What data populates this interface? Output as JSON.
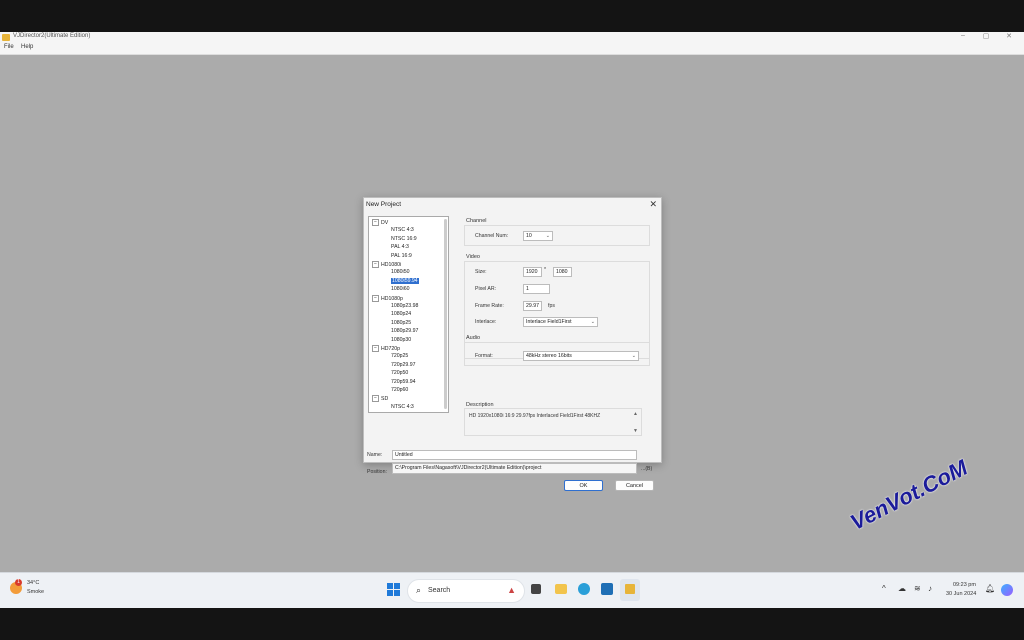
{
  "window": {
    "title": "VJDirector2(Ultimate Edition)",
    "controls": [
      "–",
      "▢",
      "✕"
    ]
  },
  "menu": [
    "File",
    "Help"
  ],
  "dialog": {
    "title": "New Project",
    "close": "✕",
    "tree": [
      {
        "label": "DV",
        "level": 0,
        "toggle": "−"
      },
      {
        "label": "NTSC 4:3",
        "level": 1
      },
      {
        "label": "NTSC 16:9",
        "level": 1
      },
      {
        "label": "PAL 4:3",
        "level": 1
      },
      {
        "label": "PAL 16:9",
        "level": 1
      },
      {
        "label": "HD1080i",
        "level": 0,
        "toggle": "−"
      },
      {
        "label": "1080i50",
        "level": 1
      },
      {
        "label": "1080i59.94",
        "level": 1,
        "selected": true
      },
      {
        "label": "1080i60",
        "level": 1
      },
      {
        "label": "HD1080p",
        "level": 0,
        "toggle": "−"
      },
      {
        "label": "1080p23.98",
        "level": 1
      },
      {
        "label": "1080p24",
        "level": 1
      },
      {
        "label": "1080p25",
        "level": 1
      },
      {
        "label": "1080p29.97",
        "level": 1
      },
      {
        "label": "1080p30",
        "level": 1
      },
      {
        "label": "HD720p",
        "level": 0,
        "toggle": "−"
      },
      {
        "label": "720p25",
        "level": 1
      },
      {
        "label": "720p29.97",
        "level": 1
      },
      {
        "label": "720p50",
        "level": 1
      },
      {
        "label": "720p59.94",
        "level": 1
      },
      {
        "label": "720p60",
        "level": 1
      },
      {
        "label": "SD",
        "level": 0,
        "toggle": "−"
      },
      {
        "label": "NTSC 4:3",
        "level": 1
      }
    ],
    "channel": {
      "group": "Channel",
      "num_label": "Channel Num:",
      "num_value": "10"
    },
    "video": {
      "group": "Video",
      "size_label": "Size:",
      "size_w": "1920",
      "size_sep": "*",
      "size_h": "1080",
      "pixel_label": "Pixel AR:",
      "pixel_value": "1",
      "frame_label": "Frame Rate:",
      "frame_value": "29.97",
      "frame_unit": "fps",
      "interlace_label": "Interlace:",
      "interlace_value": "Interlace Field1First"
    },
    "audio": {
      "group": "Audio",
      "format_label": "Format:",
      "format_value": "48kHz stereo 16bits"
    },
    "description": {
      "group": "Description",
      "text": "HD 1920x1080i 16:9 29.97fps Interlaced Field1First 48KHZ"
    },
    "name_label": "Name:",
    "name_value": "Untitled",
    "position_label": "Position:",
    "position_value": "C:\\Program Files\\Nagasoft\\VJDirector2(Ultimate Edition)\\project",
    "browse_label": "...(B)",
    "ok_label": "OK",
    "cancel_label": "Cancel"
  },
  "taskbar": {
    "weather_temp": "34°C",
    "weather_desc": "Smoke",
    "weather_badge": "1",
    "search_placeholder": "Search",
    "time": "09:23 pm",
    "date": "30 Jun 2024"
  },
  "watermark": "VenVot.CoM",
  "colors": {
    "accent": "#2f6fcf",
    "workspace": "#ababab",
    "watermark": "#1b1b9a"
  }
}
